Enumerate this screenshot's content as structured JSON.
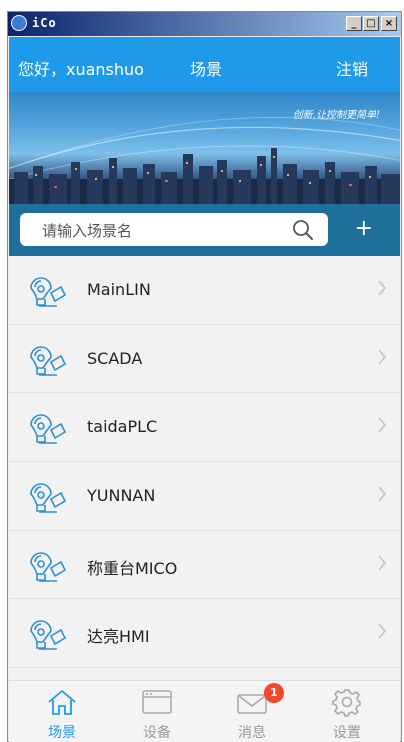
{
  "window": {
    "title": "iCo",
    "minimize": "_",
    "maximize": "□",
    "close": "×"
  },
  "header": {
    "greeting": "您好，xuanshuo",
    "scene_label": "场景",
    "logout_label": "注销"
  },
  "banner": {
    "slogan": "创新,让控制更简单!"
  },
  "search": {
    "placeholder": "请输入场景名",
    "add_label": "+"
  },
  "scenes": [
    {
      "name": "MainLIN"
    },
    {
      "name": "SCADA"
    },
    {
      "name": "taidaPLC"
    },
    {
      "name": "YUNNAN"
    },
    {
      "name": "称重台MICO"
    },
    {
      "name": "达亮HMI"
    }
  ],
  "tabbar": {
    "active_color": "#1e9ae8",
    "tabs": [
      {
        "label": "场景",
        "icon": "home-icon",
        "active": true
      },
      {
        "label": "设备",
        "icon": "device-icon",
        "active": false
      },
      {
        "label": "消息",
        "icon": "mail-icon",
        "active": false,
        "badge": "1"
      },
      {
        "label": "设置",
        "icon": "gear-icon",
        "active": false
      }
    ]
  }
}
